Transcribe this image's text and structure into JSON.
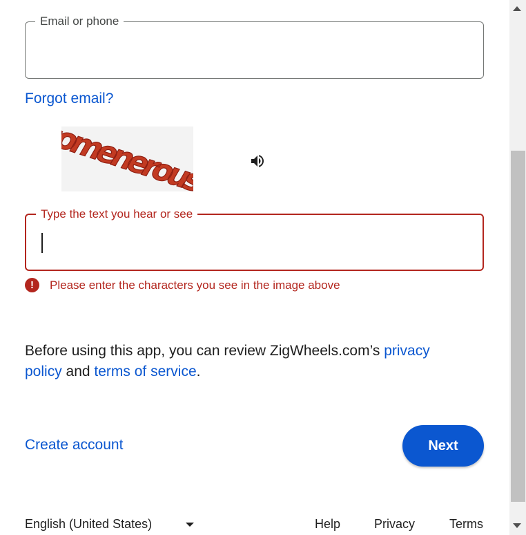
{
  "email_field": {
    "label": "Email or phone",
    "value": ""
  },
  "forgot_email": "Forgot email?",
  "captcha": {
    "text": "somenerous"
  },
  "captcha_field": {
    "label": "Type the text you hear or see",
    "value": ""
  },
  "error": {
    "message": "Please enter the characters you see in the image above"
  },
  "consent": {
    "prefix": "Before using this app, you can review ZigWheels.com’s ",
    "privacy_link": "privacy policy",
    "middle": " and ",
    "terms_link": "terms of service",
    "suffix": "."
  },
  "actions": {
    "create_account": "Create account",
    "next": "Next"
  },
  "footer": {
    "language": "English (United States)",
    "help": "Help",
    "privacy": "Privacy",
    "terms": "Terms"
  },
  "colors": {
    "accent": "#0b57d0",
    "error": "#b3261e"
  }
}
